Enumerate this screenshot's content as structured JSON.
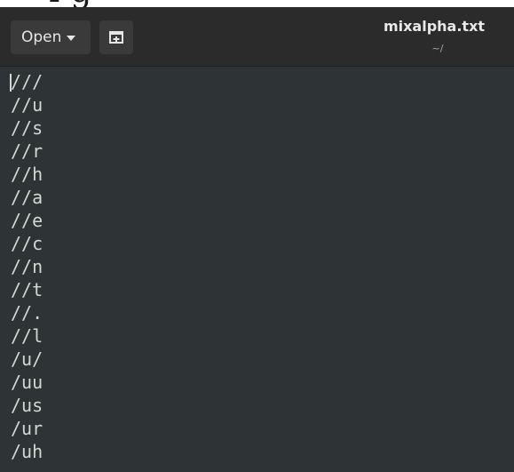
{
  "background_heading": "ı g",
  "headerbar": {
    "open_label": "Open",
    "open_icon": "chevron-down-icon",
    "new_tab_icon": "new-tab-icon",
    "title": "mixalpha.txt",
    "subtitle": "~/"
  },
  "editor": {
    "lines": [
      "///",
      "//u",
      "//s",
      "//r",
      "//h",
      "//a",
      "//e",
      "//c",
      "//n",
      "//t",
      "//.",
      "//l",
      "/u/",
      "/uu",
      "/us",
      "/ur",
      "/uh"
    ]
  },
  "colors": {
    "headerbar_bg": "#2b2b2b",
    "editor_bg": "#2e3436",
    "text": "#d3d7cf"
  }
}
